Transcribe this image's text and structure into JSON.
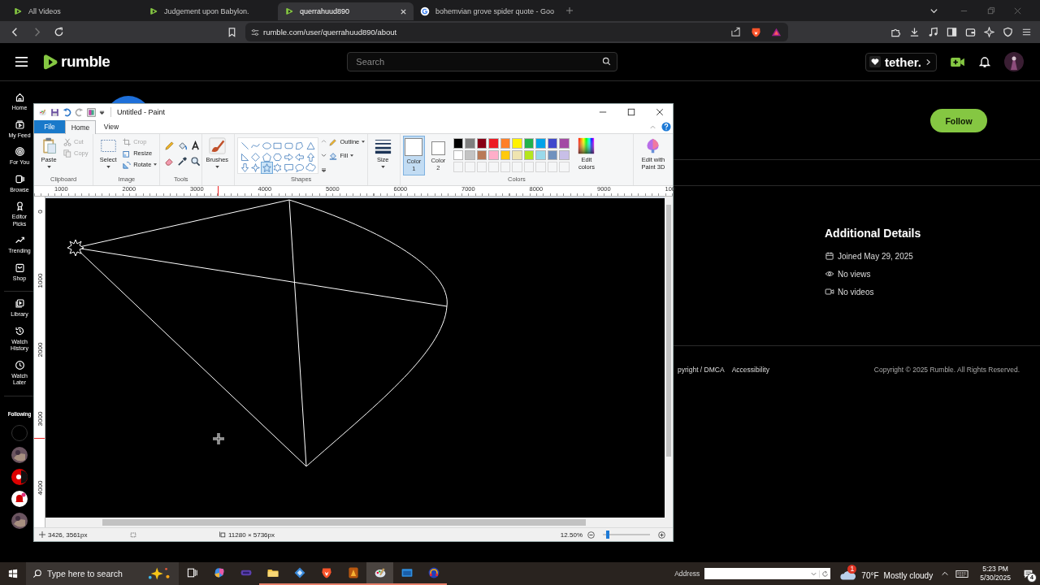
{
  "browser": {
    "tabs": [
      {
        "title": "All Videos",
        "kind": "rumble",
        "selected": false
      },
      {
        "title": "Judgement upon Babylon.",
        "kind": "rumble",
        "selected": false
      },
      {
        "title": "querrahuud890",
        "kind": "rumble",
        "selected": true
      },
      {
        "title": "bohemvian grove spider quote - Goo",
        "kind": "google",
        "selected": false
      }
    ],
    "url": "rumble.com/user/querrahuud890/about"
  },
  "site": {
    "logo": "rumble",
    "search": {
      "placeholder": "Search"
    },
    "sponsor": "tether.",
    "nav": [
      {
        "kind": "home",
        "label": "Home"
      },
      {
        "kind": "feed",
        "label": "My Feed"
      },
      {
        "kind": "foryou",
        "label": "For You"
      },
      {
        "kind": "browse",
        "label": "Browse"
      },
      {
        "kind": "picks",
        "label": "Editor Picks"
      },
      {
        "kind": "trending",
        "label": "Trending"
      },
      {
        "kind": "shop",
        "label": "Shop"
      },
      {
        "kind": "library",
        "label": "Library"
      },
      {
        "kind": "history",
        "label": "Watch History"
      },
      {
        "kind": "later",
        "label": "Watch Later"
      }
    ],
    "following": "Following",
    "channels": [
      {
        "kind": "empty"
      },
      {
        "kind": "picture"
      },
      {
        "kind": "red"
      },
      {
        "kind": "bell"
      },
      {
        "kind": "picture"
      }
    ],
    "follow_button": "Follow",
    "details": {
      "title": "Additional Details",
      "items": [
        {
          "kind": "joined",
          "text": "Joined May 29, 2025"
        },
        {
          "kind": "views",
          "text": "No views"
        },
        {
          "kind": "videos",
          "text": "No videos"
        }
      ]
    },
    "footer": {
      "links": [
        "pyright / DMCA",
        "Accessibility"
      ],
      "copyright": "Copyright © 2025 Rumble. All Rights Reserved."
    }
  },
  "paint": {
    "title": "Untitled - Paint",
    "tabs": [
      {
        "label": "File",
        "kind": "file",
        "selected": false
      },
      {
        "label": "Home",
        "kind": "tab",
        "selected": true
      },
      {
        "label": "View",
        "kind": "tab",
        "selected": false
      }
    ],
    "clipboard": {
      "paste": "Paste",
      "cut": {
        "label": "Cut",
        "disabled": true
      },
      "copy": {
        "label": "Copy",
        "disabled": true
      },
      "group": "Clipboard"
    },
    "image": {
      "select": "Select",
      "crop": {
        "label": "Crop",
        "disabled": true
      },
      "resize": "Resize",
      "rotate": "Rotate",
      "group": "Image"
    },
    "tools_group": "Tools",
    "brushes": "Brushes",
    "shapes": {
      "items": [
        {
          "kind": "line",
          "selected": false
        },
        {
          "kind": "curve",
          "selected": false
        },
        {
          "kind": "oval",
          "selected": false
        },
        {
          "kind": "rectangle",
          "selected": false
        },
        {
          "kind": "rounded-rectangle",
          "selected": false
        },
        {
          "kind": "polygon",
          "selected": false
        },
        {
          "kind": "triangle",
          "selected": false
        },
        {
          "kind": "right-triangle",
          "selected": false
        },
        {
          "kind": "diamond",
          "selected": false
        },
        {
          "kind": "pentagon",
          "selected": false
        },
        {
          "kind": "hexagon",
          "selected": false
        },
        {
          "kind": "right-arrow",
          "selected": false
        },
        {
          "kind": "left-arrow",
          "selected": false
        },
        {
          "kind": "up-arrow",
          "selected": false
        },
        {
          "kind": "down-arrow",
          "selected": false
        },
        {
          "kind": "star4",
          "selected": false
        },
        {
          "kind": "star5",
          "selected": true
        },
        {
          "kind": "star6",
          "selected": false
        },
        {
          "kind": "rect-callout",
          "selected": false
        },
        {
          "kind": "oval-callout",
          "selected": false
        },
        {
          "kind": "cloud-callout",
          "selected": false
        }
      ],
      "outline": "Outline",
      "fill": "Fill",
      "group": "Shapes"
    },
    "size": "Size",
    "color1": {
      "label": "Color 1",
      "color": "#ffffff",
      "selected": true
    },
    "color2": {
      "label": "Color 2",
      "color": "#ffffff",
      "selected": false
    },
    "palette": [
      {
        "color": "#000000"
      },
      {
        "color": "#7f7f7f"
      },
      {
        "color": "#880015"
      },
      {
        "color": "#ed1c24"
      },
      {
        "color": "#ff7f27"
      },
      {
        "color": "#fff200"
      },
      {
        "color": "#22b14c"
      },
      {
        "color": "#00a2e8"
      },
      {
        "color": "#3f48cc"
      },
      {
        "color": "#a349a4"
      },
      {
        "color": "#ffffff"
      },
      {
        "color": "#c3c3c3"
      },
      {
        "color": "#b97a57"
      },
      {
        "color": "#ffaec9"
      },
      {
        "color": "#ffc90e"
      },
      {
        "color": "#efe4b0"
      },
      {
        "color": "#b5e61d"
      },
      {
        "color": "#99d9ea"
      },
      {
        "color": "#7092be"
      },
      {
        "color": "#c8bfe7"
      }
    ],
    "colors_group": "Colors",
    "edit_colors": "Edit colors",
    "paint3d": "Edit with Paint 3D",
    "hruler": [
      "1000",
      "2000",
      "3000",
      "4000",
      "5000",
      "6000",
      "7000",
      "8000",
      "9000",
      "100"
    ],
    "vruler": [
      "0",
      "1000",
      "2000",
      "3000",
      "4000"
    ],
    "status": {
      "position": "3426, 3561px",
      "canvas_size": "11280 × 5736px",
      "zoom": "12.50%",
      "zoom_slider": {
        "level": 0.1
      }
    }
  },
  "taskbar": {
    "search_placeholder": "Type here to search",
    "apps": [
      {
        "kind": "taskview",
        "running": false,
        "selected": false
      },
      {
        "kind": "copilot",
        "running": false,
        "selected": false
      },
      {
        "kind": "terminal",
        "running": false,
        "selected": false
      },
      {
        "kind": "folder",
        "running": true,
        "selected": false
      },
      {
        "kind": "diamond",
        "running": true,
        "selected": false
      },
      {
        "kind": "lion",
        "running": true,
        "selected": false
      },
      {
        "kind": "game",
        "running": true,
        "selected": false
      },
      {
        "kind": "paint",
        "running": true,
        "selected": true
      },
      {
        "kind": "window",
        "running": true,
        "selected": false
      },
      {
        "kind": "headphones",
        "running": true,
        "selected": false
      }
    ],
    "address_label": "Address",
    "weather": {
      "badge": "1",
      "temp": "70°F",
      "condition": "Mostly cloudy"
    },
    "time": "5:23 PM",
    "date": "5/30/2025",
    "notifications": "4"
  }
}
